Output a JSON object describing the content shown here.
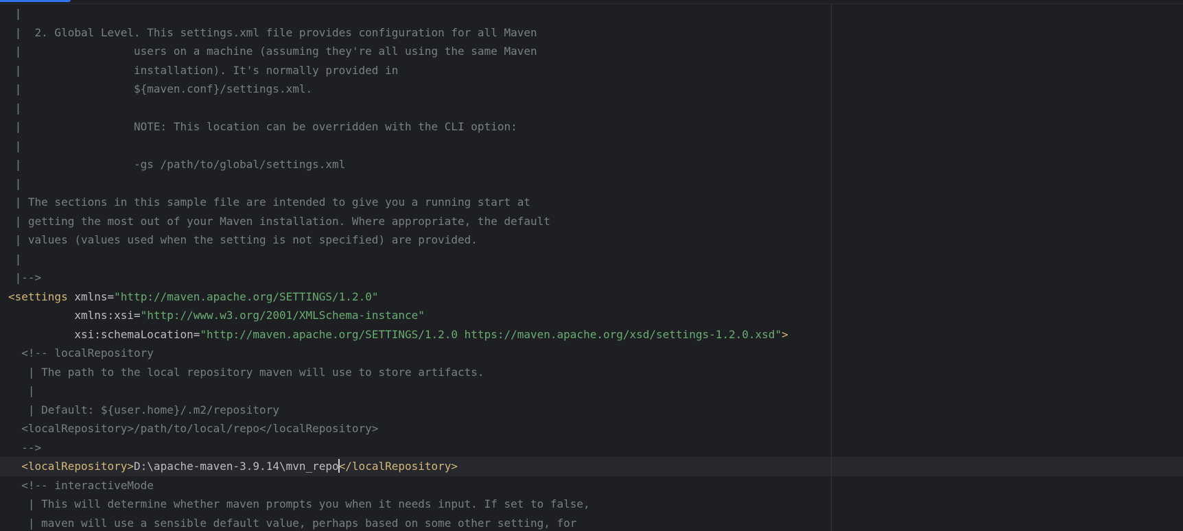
{
  "editor": {
    "language": "xml",
    "caret_line": 25,
    "colors": {
      "background": "#1e1f22",
      "comment": "#7a7e85",
      "tag": "#d5b778",
      "attribute": "#bcbec4",
      "string": "#6aab73",
      "text": "#bcbec4",
      "caret_line_background": "#26282e",
      "accent": "#3574f0"
    },
    "lines": [
      {
        "tokens": [
          {
            "t": "comment",
            "v": " |"
          }
        ]
      },
      {
        "tokens": [
          {
            "t": "comment",
            "v": " |  2. Global Level. This settings.xml file provides configuration for all Maven"
          }
        ]
      },
      {
        "tokens": [
          {
            "t": "comment",
            "v": " |                 users on a machine (assuming they're all using the same Maven"
          }
        ]
      },
      {
        "tokens": [
          {
            "t": "comment",
            "v": " |                 installation). It's normally provided in"
          }
        ]
      },
      {
        "tokens": [
          {
            "t": "comment",
            "v": " |                 ${maven.conf}/settings.xml."
          }
        ]
      },
      {
        "tokens": [
          {
            "t": "comment",
            "v": " |"
          }
        ]
      },
      {
        "tokens": [
          {
            "t": "comment",
            "v": " |                 NOTE: This location can be overridden with the CLI option:"
          }
        ]
      },
      {
        "tokens": [
          {
            "t": "comment",
            "v": " |"
          }
        ]
      },
      {
        "tokens": [
          {
            "t": "comment",
            "v": " |                 -gs /path/to/global/settings.xml"
          }
        ]
      },
      {
        "tokens": [
          {
            "t": "comment",
            "v": " |"
          }
        ]
      },
      {
        "tokens": [
          {
            "t": "comment",
            "v": " | The sections in this sample file are intended to give you a running start at"
          }
        ]
      },
      {
        "tokens": [
          {
            "t": "comment",
            "v": " | getting the most out of your Maven installation. Where appropriate, the default"
          }
        ]
      },
      {
        "tokens": [
          {
            "t": "comment",
            "v": " | values (values used when the setting is not specified) are provided."
          }
        ]
      },
      {
        "tokens": [
          {
            "t": "comment",
            "v": " |"
          }
        ]
      },
      {
        "tokens": [
          {
            "t": "comment",
            "v": " |-->"
          }
        ]
      },
      {
        "tokens": [
          {
            "t": "tag",
            "v": "<settings"
          },
          {
            "t": "text",
            "v": " "
          },
          {
            "t": "attr",
            "v": "xmlns"
          },
          {
            "t": "punct",
            "v": "="
          },
          {
            "t": "string",
            "v": "\"http://maven.apache.org/SETTINGS/1.2.0\""
          }
        ]
      },
      {
        "tokens": [
          {
            "t": "text",
            "v": "          "
          },
          {
            "t": "attr",
            "v": "xmlns:xsi"
          },
          {
            "t": "punct",
            "v": "="
          },
          {
            "t": "string",
            "v": "\"http://www.w3.org/2001/XMLSchema-instance\""
          }
        ]
      },
      {
        "tokens": [
          {
            "t": "text",
            "v": "          "
          },
          {
            "t": "attr",
            "v": "xsi:schemaLocation"
          },
          {
            "t": "punct",
            "v": "="
          },
          {
            "t": "string",
            "v": "\"http://maven.apache.org/SETTINGS/1.2.0 https://maven.apache.org/xsd/settings-1.2.0.xsd\""
          },
          {
            "t": "tag",
            "v": ">"
          }
        ]
      },
      {
        "tokens": [
          {
            "t": "comment",
            "v": "  <!-- localRepository"
          }
        ]
      },
      {
        "tokens": [
          {
            "t": "comment",
            "v": "   | The path to the local repository maven will use to store artifacts."
          }
        ]
      },
      {
        "tokens": [
          {
            "t": "comment",
            "v": "   |"
          }
        ]
      },
      {
        "tokens": [
          {
            "t": "comment",
            "v": "   | Default: ${user.home}/.m2/repository"
          }
        ]
      },
      {
        "tokens": [
          {
            "t": "comment",
            "v": "  <localRepository>/path/to/local/repo</localRepository>"
          }
        ]
      },
      {
        "tokens": [
          {
            "t": "comment",
            "v": "  -->"
          }
        ]
      },
      {
        "tokens": [
          {
            "t": "text",
            "v": "  "
          },
          {
            "t": "tag",
            "v": "<localRepository>"
          },
          {
            "t": "text",
            "v": "D:\\apache-maven-3.9.14\\mvn_repo"
          },
          {
            "t": "caret",
            "v": ""
          },
          {
            "t": "tag",
            "v": "</localRepository>"
          }
        ]
      },
      {
        "tokens": [
          {
            "t": "comment",
            "v": "  <!-- interactiveMode"
          }
        ]
      },
      {
        "tokens": [
          {
            "t": "comment",
            "v": "   | This will determine whether maven prompts you when it needs input. If set to false,"
          }
        ]
      },
      {
        "tokens": [
          {
            "t": "comment",
            "v": "   | maven will use a sensible default value, perhaps based on some other setting, for"
          }
        ]
      }
    ]
  }
}
